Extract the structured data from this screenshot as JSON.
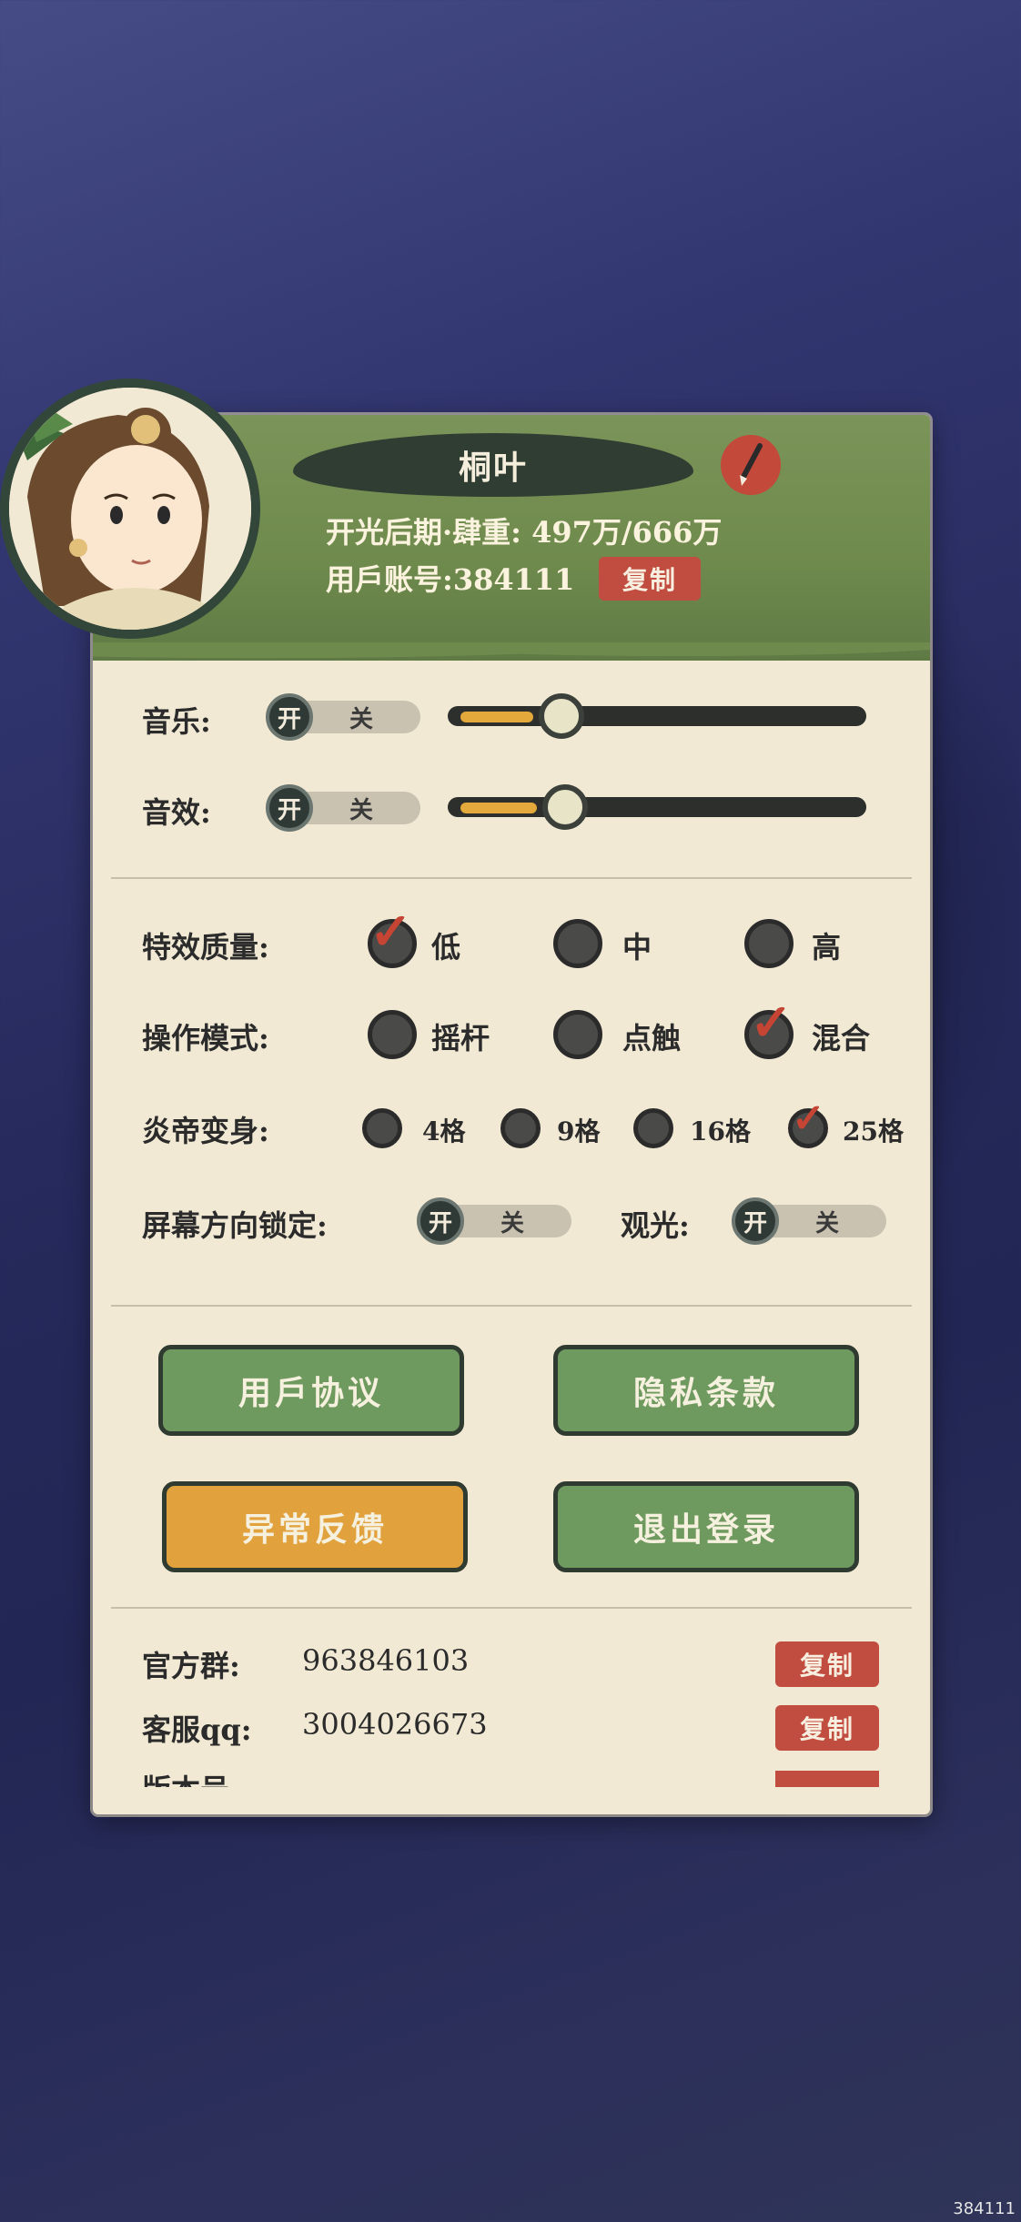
{
  "profile": {
    "name": "桐叶",
    "realm_label": "开光后期·肆重:",
    "realm_value": "497万/666万",
    "account_label": "用戶账号:",
    "account_id": "384111",
    "copy_label": "复制"
  },
  "audio": {
    "music_label": "音乐:",
    "sfx_label": "音效:",
    "on_label": "开",
    "off_label": "关",
    "music_volume": 0.2,
    "sfx_volume": 0.2
  },
  "settings": {
    "effects_label": "特效质量:",
    "effects_options": [
      "低",
      "中",
      "高"
    ],
    "effects_selected": "低",
    "control_label": "操作模式:",
    "control_options": [
      "摇杆",
      "点触",
      "混合"
    ],
    "control_selected": "混合",
    "transform_label": "炎帝变身:",
    "transform_options": [
      "4格",
      "9格",
      "16格",
      "25格"
    ],
    "transform_selected": "25格",
    "orientation_label": "屏幕方向锁定:",
    "sightseeing_label": "观光:",
    "on_label": "开",
    "off_label": "关"
  },
  "buttons": {
    "user_agreement": "用戶协议",
    "privacy": "隐私条款",
    "feedback": "异常反馈",
    "logout": "退出登录"
  },
  "info": {
    "group_label": "官方群:",
    "group_value": "963846103",
    "service_label": "客服qq:",
    "service_value": "3004026673",
    "version_label": "版本号",
    "copy_label": "复制"
  },
  "watermark": "384111"
}
